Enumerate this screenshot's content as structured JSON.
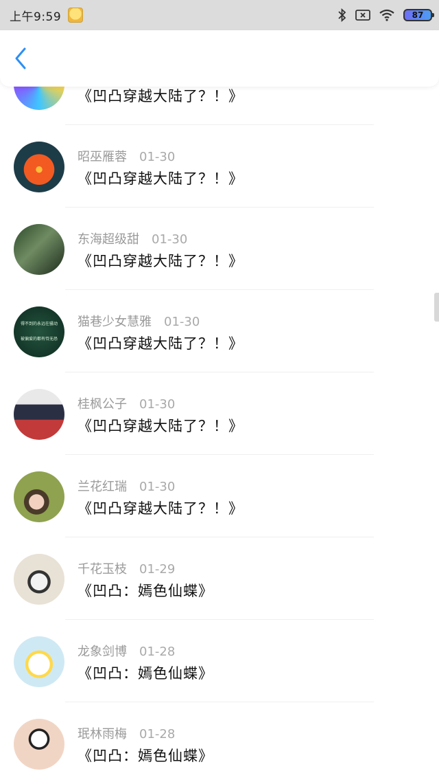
{
  "status_bar": {
    "time": "上午9:59",
    "battery_level": "87",
    "icons": [
      "bluetooth-icon",
      "sim-off-icon",
      "wifi-icon",
      "battery-icon"
    ]
  },
  "nav": {
    "back_icon": "chevron-left-icon",
    "accent_color": "#2c8ff5"
  },
  "items": [
    {
      "name": "",
      "date": "",
      "title": "《凹凸穿越大陆了？！》"
    },
    {
      "name": "昭巫雁蓉",
      "date": "01-30",
      "title": "《凹凸穿越大陆了？！》"
    },
    {
      "name": "东海超级甜",
      "date": "01-30",
      "title": "《凹凸穿越大陆了？！》"
    },
    {
      "name": "猫巷少女慧雅",
      "date": "01-30",
      "title": "《凹凸穿越大陆了？！》",
      "avatar_text": [
        "得不到的永远在骚动",
        "被偏爱的都有恃无恐"
      ]
    },
    {
      "name": "桂枫公子",
      "date": "01-30",
      "title": "《凹凸穿越大陆了？！》"
    },
    {
      "name": "兰花红瑞",
      "date": "01-30",
      "title": "《凹凸穿越大陆了？！》"
    },
    {
      "name": "千花玉枝",
      "date": "01-29",
      "title": "《凹凸：嫣色仙蝶》"
    },
    {
      "name": "龙象剑博",
      "date": "01-28",
      "title": "《凹凸：嫣色仙蝶》"
    },
    {
      "name": "珉林雨梅",
      "date": "01-28",
      "title": "《凹凸：嫣色仙蝶》"
    }
  ]
}
